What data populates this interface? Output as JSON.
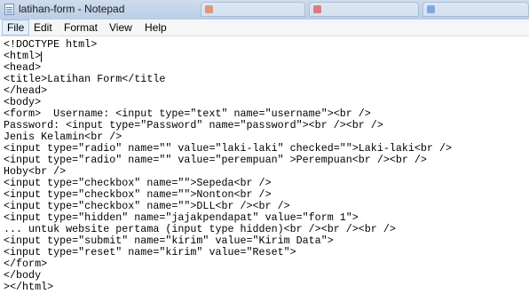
{
  "window": {
    "title": "latihan-form - Notepad",
    "icon": "notepad-icon",
    "background_tabs": [
      "",
      "",
      ""
    ]
  },
  "menu": {
    "items": [
      "File",
      "Edit",
      "Format",
      "View",
      "Help"
    ]
  },
  "editor": {
    "lines": [
      "<!DOCTYPE html>",
      "<html>",
      "<head>",
      "<title>Latihan Form</title",
      "</head>",
      "<body>",
      "<form>  Username: <input type=\"text\" name=\"username\"><br />",
      "Password: <input type=\"Password\" name=\"password\"><br /><br />",
      "Jenis Kelamin<br />",
      "<input type=\"radio\" name=\"\" value=\"laki-laki\" checked=\"\">Laki-laki<br />",
      "<input type=\"radio\" name=\"\" value=\"perempuan\" >Perempuan<br /><br />",
      "Hoby<br />",
      "<input type=\"checkbox\" name=\"\">Sepeda<br />",
      "<input type=\"checkbox\" name=\"\">Nonton<br />",
      "<input type=\"checkbox\" name=\"\">DLL<br /><br />",
      "<input type=\"hidden\" name=\"jajakpendapat\" value=\"form 1\">",
      "... untuk website pertama (input type hidden)<br /><br /><br />",
      "<input type=\"submit\" name=\"kirim\" value=\"Kirim Data\">",
      "<input type=\"reset\" name=\"kirim\" value=\"Reset\">",
      "</form>",
      "</body",
      "></html>"
    ]
  }
}
